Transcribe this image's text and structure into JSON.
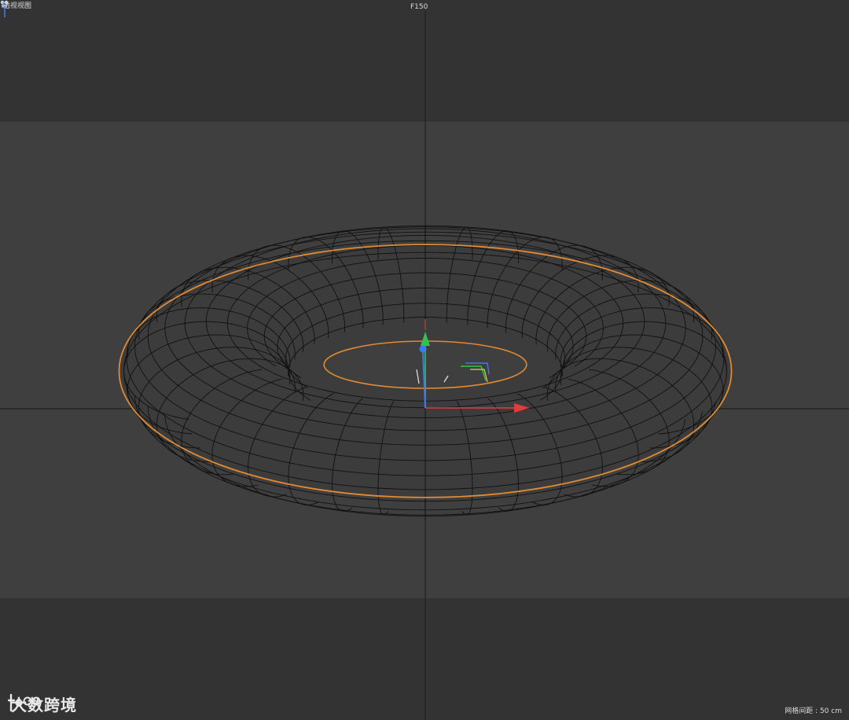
{
  "viewport": {
    "view_name": "透视视图",
    "frame": "F150",
    "grid_spacing": "网格间距 : 50 cm",
    "axis_letter": "Y"
  },
  "object": {
    "type": "torus",
    "selected": true,
    "outline_color": "#e08a33",
    "wire_color": "#111111"
  },
  "gizmo": {
    "x_color": "#e03c3c",
    "y_color": "#36c24a",
    "z_color": "#3a7cf0"
  },
  "colors": {
    "background": "#333333",
    "floor": "#3f3f3f",
    "axis_line": "#1f1f1f",
    "surface": "#3c3c3c"
  },
  "watermark": {
    "text": "大数跨境",
    "logo_icon": "tbo-logo-icon"
  }
}
